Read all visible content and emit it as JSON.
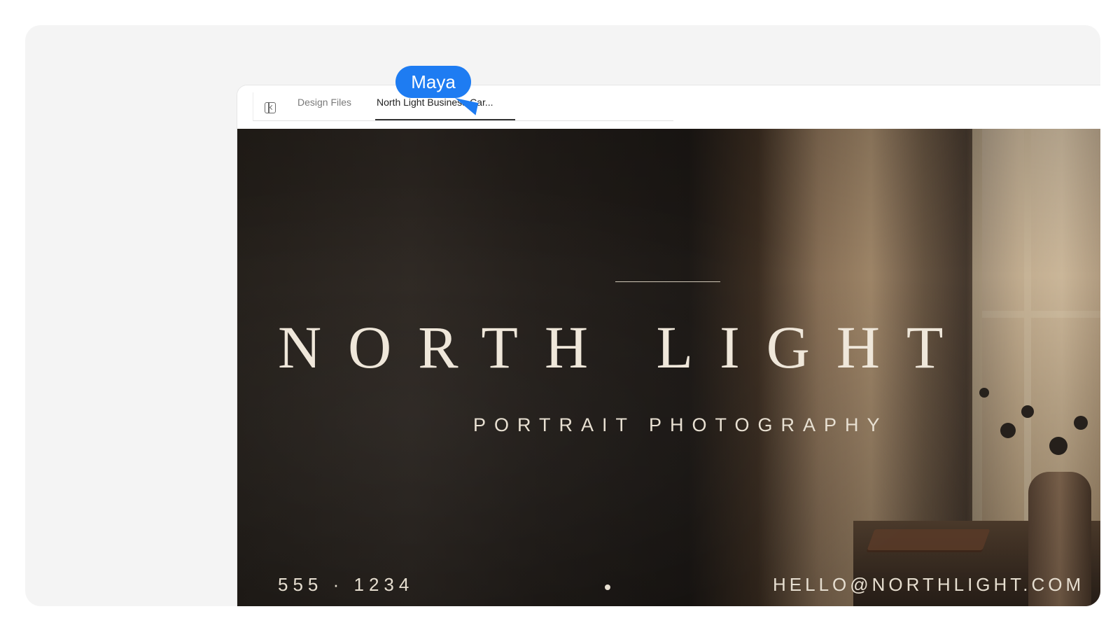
{
  "tabbar": {
    "tabs": [
      {
        "label": "Design Files",
        "active": false
      },
      {
        "label": "North Light Business Car...",
        "active": true
      }
    ]
  },
  "collaborator": {
    "name": "Maya",
    "color": "#1e7cf2"
  },
  "design": {
    "brand": "NORTH LIGHT",
    "tagline": "PORTRAIT PHOTOGRAPHY",
    "phone": "555 · 1234",
    "email": "HELLO@NORTHLIGHT.COM",
    "text_color": "#efe7da"
  }
}
